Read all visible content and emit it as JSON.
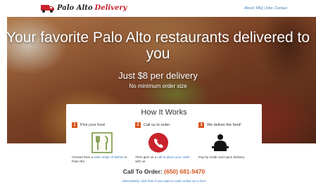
{
  "brand": {
    "name_part1": "Palo Alto",
    "name_part2": "Delivery",
    "brand_color": "#c8232c"
  },
  "nav": {
    "items": [
      "About",
      "FAQ",
      "Jobs",
      "Contact"
    ],
    "separator": "|",
    "link_color": "#3a78b5"
  },
  "hero": {
    "headline": "Your favorite Palo Alto restaurants delivered to you",
    "price": "Just $8 per delivery",
    "subtext": "No minimum order size"
  },
  "how_it_works": {
    "title": "How It Works",
    "accent_color": "#d9541e",
    "steps": [
      {
        "number": "1",
        "label": "Pick your food",
        "icon": "fork-knife-icon",
        "desc_before": "Choose from a ",
        "desc_link": "wide range of dishes",
        "desc_after": " in Palo Alto"
      },
      {
        "number": "2",
        "label": "Call us to order",
        "icon": "phone-icon",
        "desc_before": "Then give us a ",
        "desc_link": "call to place your order",
        "desc_after": " with us"
      },
      {
        "number": "3",
        "label": "We deliver the food!",
        "icon": "delivery-person-icon",
        "desc_before": "Pay by credit card upon delivery",
        "desc_link": "",
        "desc_after": ""
      }
    ]
  },
  "order": {
    "label": "Call To Order:",
    "phone": "(650) 681-9470",
    "alt_text": "Alternatively, click here if you want to order online via a form"
  }
}
